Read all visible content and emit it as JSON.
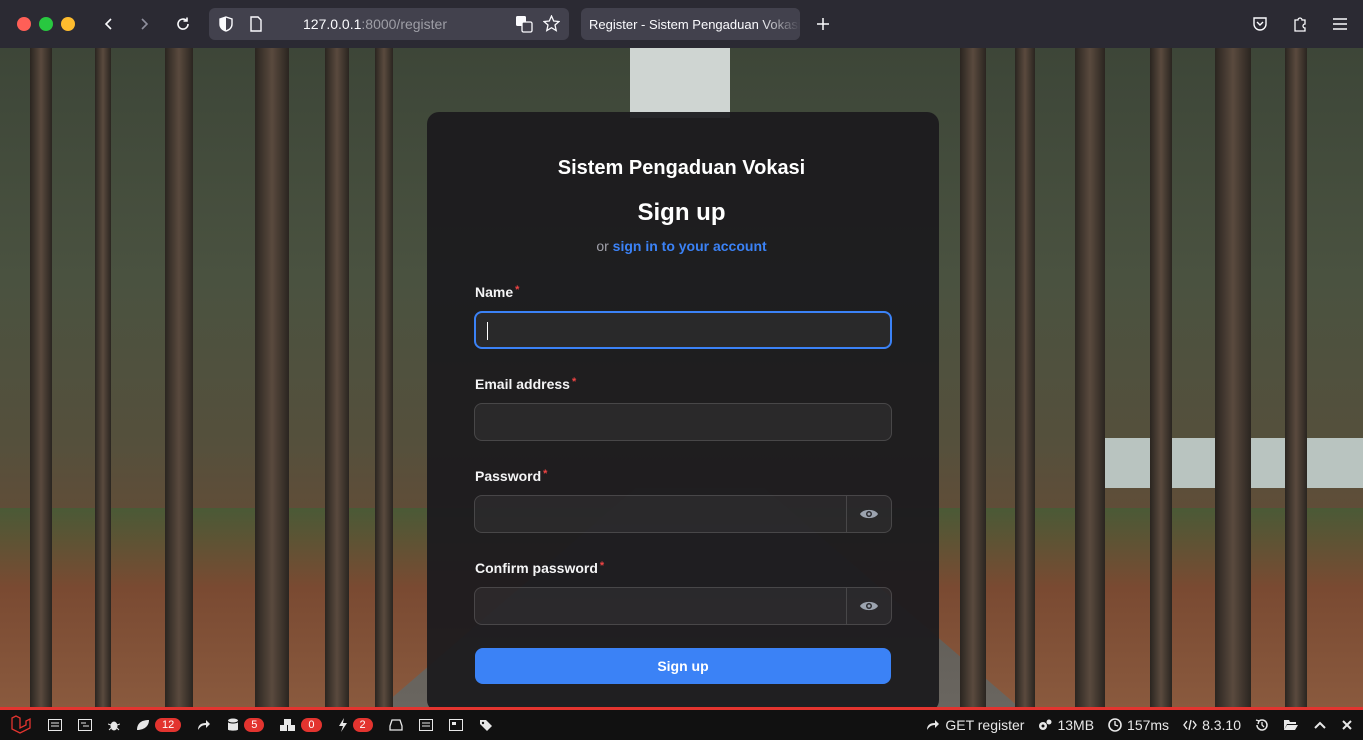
{
  "browser": {
    "url_host": "127.0.0.1",
    "url_rest": ":8000/register",
    "tab_title": "Register - Sistem Pengaduan Vokasi"
  },
  "page": {
    "brand": "Sistem Pengaduan Vokasi",
    "heading": "Sign up",
    "sub_prefix": "or",
    "sub_link": "sign in to your account",
    "fields": {
      "name_label": "Name",
      "email_label": "Email address",
      "password_label": "Password",
      "confirm_label": "Confirm password",
      "required_mark": "*"
    },
    "submit_label": "Sign up",
    "accent": "#3b82f6"
  },
  "debugbar": {
    "views_count": "12",
    "queries_count": "5",
    "models_count": "0",
    "events_count": "2",
    "route": "GET register",
    "memory": "13MB",
    "time": "157ms",
    "php_version": "8.3.10"
  }
}
